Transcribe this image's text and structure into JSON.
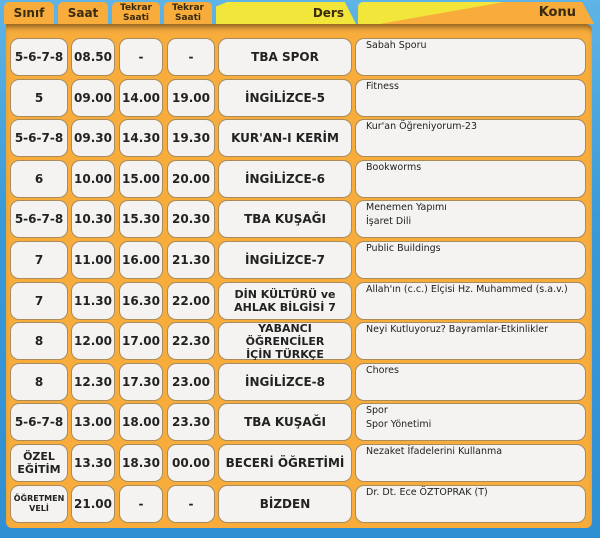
{
  "headers": {
    "sinif": "Sınıf",
    "saat": "Saat",
    "tekrar1_line1": "Tekrar",
    "tekrar1_line2": "Saati",
    "tekrar2_line1": "Tekrar",
    "tekrar2_line2": "Saati",
    "ders": "Ders",
    "konu": "Konu"
  },
  "colors": {
    "panel": "#f7ac3c",
    "tab_highlight": "#f2e63a",
    "background": "#3a9ad8",
    "cell": "#f4f3f1"
  },
  "rows": [
    {
      "sinif": "5-6-7-8",
      "saat": "08.50",
      "tekrar1": "-",
      "tekrar2": "-",
      "ders": "TBA SPOR",
      "konu": [
        "Sabah Sporu"
      ]
    },
    {
      "sinif": "5",
      "saat": "09.00",
      "tekrar1": "14.00",
      "tekrar2": "19.00",
      "ders": "İNGİLİZCE-5",
      "konu": [
        "Fitness"
      ]
    },
    {
      "sinif": "5-6-7-8",
      "saat": "09.30",
      "tekrar1": "14.30",
      "tekrar2": "19.30",
      "ders": "KUR'AN-I KERİM",
      "konu": [
        "Kur'an Öğreniyorum-23"
      ]
    },
    {
      "sinif": "6",
      "saat": "10.00",
      "tekrar1": "15.00",
      "tekrar2": "20.00",
      "ders": "İNGİLİZCE-6",
      "konu": [
        "Bookworms"
      ]
    },
    {
      "sinif": "5-6-7-8",
      "saat": "10.30",
      "tekrar1": "15.30",
      "tekrar2": "20.30",
      "ders": "TBA KUŞAĞI",
      "konu": [
        "Menemen Yapımı",
        "İşaret Dili"
      ]
    },
    {
      "sinif": "7",
      "saat": "11.00",
      "tekrar1": "16.00",
      "tekrar2": "21.30",
      "ders": "İNGİLİZCE-7",
      "konu": [
        "Public Buildings"
      ]
    },
    {
      "sinif": "7",
      "saat": "11.30",
      "tekrar1": "16.30",
      "tekrar2": "22.00",
      "ders": [
        "DİN KÜLTÜRÜ ve",
        "AHLAK BİLGİSİ 7"
      ],
      "konu": [
        "Allah'ın (c.c.) Elçisi Hz. Muhammed (s.a.v.)"
      ]
    },
    {
      "sinif": "8",
      "saat": "12.00",
      "tekrar1": "17.00",
      "tekrar2": "22.30",
      "ders": [
        "YABANCI ÖĞRENCİLER",
        "İÇİN TÜRKÇE"
      ],
      "konu": [
        "Neyi Kutluyoruz? Bayramlar-Etkinlikler"
      ]
    },
    {
      "sinif": "8",
      "saat": "12.30",
      "tekrar1": "17.30",
      "tekrar2": "23.00",
      "ders": "İNGİLİZCE-8",
      "konu": [
        "Chores"
      ]
    },
    {
      "sinif": "5-6-7-8",
      "saat": "13.00",
      "tekrar1": "18.00",
      "tekrar2": "23.30",
      "ders": "TBA KUŞAĞI",
      "konu": [
        "Spor",
        "Spor Yönetimi"
      ]
    },
    {
      "sinif": [
        "ÖZEL",
        "EĞİTİM"
      ],
      "saat": "13.30",
      "tekrar1": "18.30",
      "tekrar2": "00.00",
      "ders": "BECERİ ÖĞRETİMİ",
      "konu": [
        "Nezaket İfadelerini Kullanma"
      ]
    },
    {
      "sinif": [
        "ÖĞRETMEN",
        "VELİ"
      ],
      "saat": "21.00",
      "tekrar1": "-",
      "tekrar2": "-",
      "ders": "BİZDEN",
      "konu": [
        "Dr. Dt. Ece ÖZTOPRAK (T)"
      ]
    }
  ]
}
